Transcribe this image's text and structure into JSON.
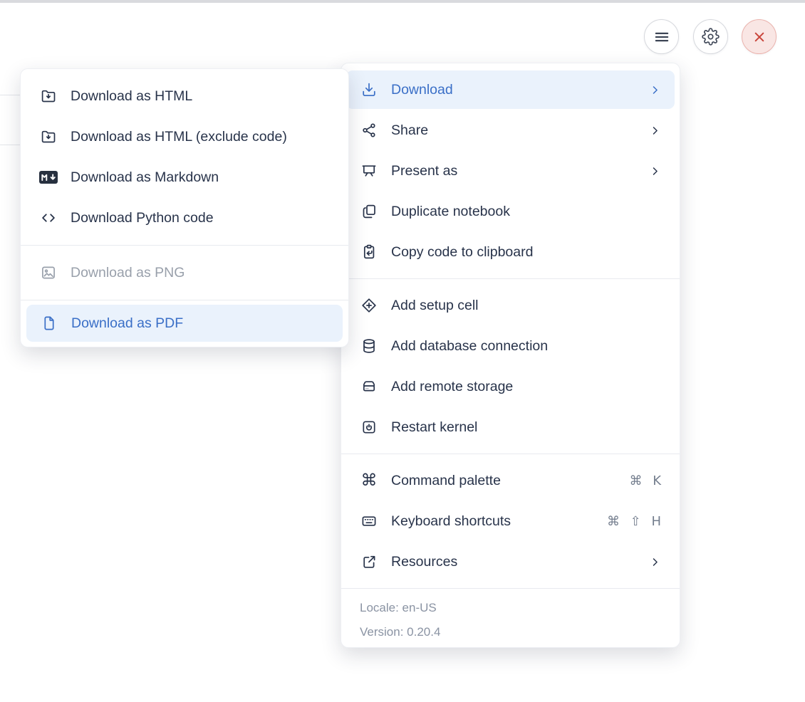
{
  "theme": {
    "accent": "#3A6FC7",
    "accent_bg": "#EAF2FC",
    "danger": "#C9453B",
    "text": "#28334A",
    "muted": "#8A93A3",
    "disabled": "#99A0AB",
    "topbar": "#D9DADE"
  },
  "glyphs": {
    "command": "⌘"
  },
  "toolbar": {
    "buttons": [
      {
        "name": "menu",
        "icon": "hamburger-icon"
      },
      {
        "name": "settings",
        "icon": "gear-icon"
      },
      {
        "name": "close",
        "icon": "close-icon"
      }
    ]
  },
  "main_menu": {
    "groups": [
      {
        "items": [
          {
            "label": "Download",
            "icon": "download-icon",
            "has_submenu": true,
            "active": true
          },
          {
            "label": "Share",
            "icon": "share-icon",
            "has_submenu": true
          },
          {
            "label": "Present as",
            "icon": "present-icon",
            "has_submenu": true
          },
          {
            "label": "Duplicate notebook",
            "icon": "duplicate-icon"
          },
          {
            "label": "Copy code to clipboard",
            "icon": "clipboard-arrow-icon"
          }
        ]
      },
      {
        "items": [
          {
            "label": "Add setup cell",
            "icon": "diamond-plus-icon"
          },
          {
            "label": "Add database connection",
            "icon": "database-icon"
          },
          {
            "label": "Add remote storage",
            "icon": "storage-icon"
          },
          {
            "label": "Restart kernel",
            "icon": "restart-kernel-icon"
          }
        ]
      },
      {
        "items": [
          {
            "label": "Command palette",
            "icon": "command-icon",
            "shortcut": "⌘ K"
          },
          {
            "label": "Keyboard shortcuts",
            "icon": "keyboard-icon",
            "shortcut": "⌘ ⇧ H"
          },
          {
            "label": "Resources",
            "icon": "external-link-icon",
            "has_submenu": true
          }
        ]
      }
    ],
    "footer": {
      "locale": "Locale: en-US",
      "version": "Version: 0.20.4"
    }
  },
  "download_submenu": {
    "groups": [
      {
        "items": [
          {
            "label": "Download as HTML",
            "icon": "folder-download-icon"
          },
          {
            "label": "Download as HTML (exclude code)",
            "icon": "folder-download-icon"
          },
          {
            "label": "Download as Markdown",
            "icon": "markdown-icon"
          },
          {
            "label": "Download Python code",
            "icon": "code-icon"
          }
        ]
      },
      {
        "items": [
          {
            "label": "Download as PNG",
            "icon": "image-icon",
            "disabled": true
          }
        ]
      },
      {
        "items": [
          {
            "label": "Download as PDF",
            "icon": "file-icon",
            "active": true
          }
        ]
      }
    ]
  }
}
